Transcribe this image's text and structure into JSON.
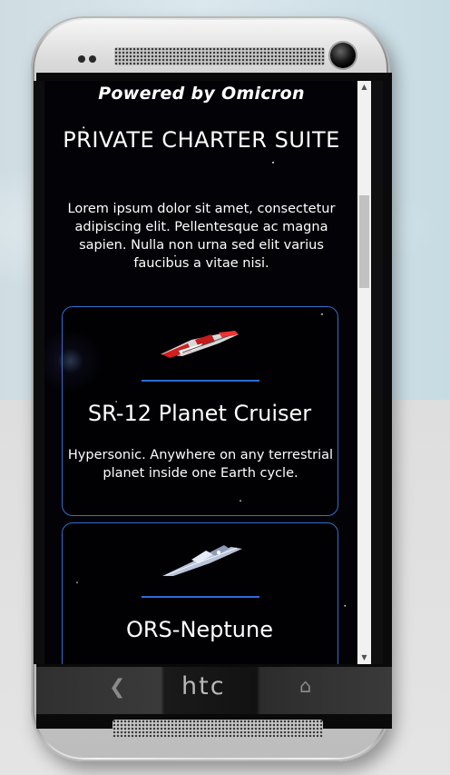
{
  "device": {
    "brand_logo": "htc",
    "nav_back_icon": "back-icon",
    "nav_home_icon": "home-icon"
  },
  "page": {
    "powered_by": "Powered by Omicron",
    "title": "PRIVATE CHARTER SUITE",
    "intro": "Lorem ipsum dolor sit amet, consectetur adipiscing elit. Pellentesque ac magna sapien. Nulla non urna sed elit varius faucibus a vitae nisi."
  },
  "cards": [
    {
      "title": "SR-12 Planet Cruiser",
      "description": "Hypersonic. Anywhere on any terrestrial planet inside one Earth cycle.",
      "accent": "#2f6fd1"
    },
    {
      "title": "ORS-Neptune",
      "description": "",
      "accent": "#2f6fd1"
    }
  ],
  "scrollbar": {
    "up_icon": "arrow-up-icon",
    "down_icon": "arrow-down-icon"
  }
}
